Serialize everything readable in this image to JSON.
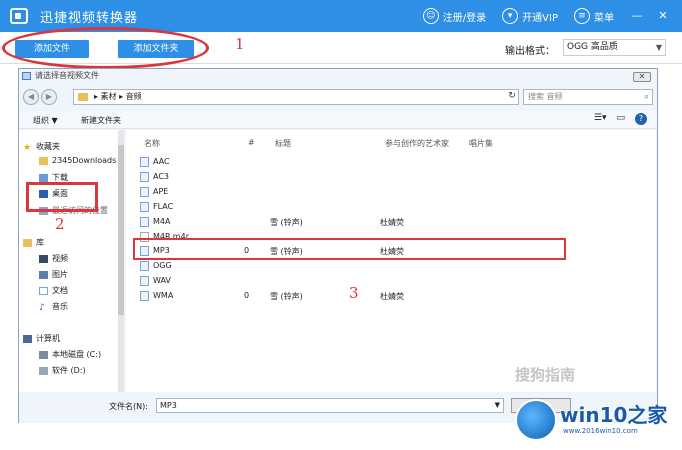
{
  "app": {
    "title": "迅捷视频转换器",
    "login_label": "注册/登录",
    "vip_label": "开通VIP",
    "menu_label": "菜单"
  },
  "toolbar": {
    "add_file_label": "添加文件",
    "add_folder_label": "添加文件夹",
    "format_label": "输出格式：",
    "format_value": "OGG 高品质"
  },
  "annotations": {
    "n1": "1",
    "n2": "2",
    "n3": "3"
  },
  "dialog": {
    "title": "请选择音视频文件",
    "close_label": "✕",
    "path": "▸ 素材 ▸ 音频",
    "search_placeholder": "搜索 音频",
    "organize_label": "组织 ▼",
    "new_folder_label": "新建文件夹",
    "nav": {
      "favorites": "收藏夹",
      "downloads_2345": "2345Downloads",
      "downloads": "下载",
      "desktop": "桌面",
      "recent": "最近访问的位置",
      "libraries": "库",
      "videos": "视频",
      "pictures": "图片",
      "documents": "文档",
      "music": "音乐",
      "computer": "计算机",
      "disk_c": "本地磁盘 (C:)",
      "disk_d": "软件 (D:)"
    },
    "columns": {
      "name": "名称",
      "number": "#",
      "title": "标题",
      "artist": "参与创作的艺术家",
      "album": "唱片集"
    },
    "files": [
      {
        "name": "AAC",
        "number": "",
        "title": "",
        "artist": ""
      },
      {
        "name": "AC3",
        "number": "",
        "title": "",
        "artist": ""
      },
      {
        "name": "APE",
        "number": "",
        "title": "",
        "artist": ""
      },
      {
        "name": "FLAC",
        "number": "",
        "title": "",
        "artist": ""
      },
      {
        "name": "M4A",
        "number": "",
        "title": "雪 (铃声)",
        "artist": "杜婧荧"
      },
      {
        "name": "M4R.m4r",
        "number": "",
        "title": "",
        "artist": ""
      },
      {
        "name": "MP3",
        "number": "0",
        "title": "雪 (铃声)",
        "artist": "杜婧荧"
      },
      {
        "name": "OGG",
        "number": "",
        "title": "",
        "artist": ""
      },
      {
        "name": "WAV",
        "number": "",
        "title": "",
        "artist": ""
      },
      {
        "name": "WMA",
        "number": "0",
        "title": "雪 (铃声)",
        "artist": "杜婧荧"
      }
    ],
    "filename_label": "文件名(N):",
    "filename_value": "MP3"
  },
  "watermark": {
    "sogou": "搜狗指南",
    "brand": "win10之家",
    "url": "www.2016win10.com"
  },
  "colors": {
    "accent": "#2e8fe6",
    "annotation": "#d9363e"
  }
}
